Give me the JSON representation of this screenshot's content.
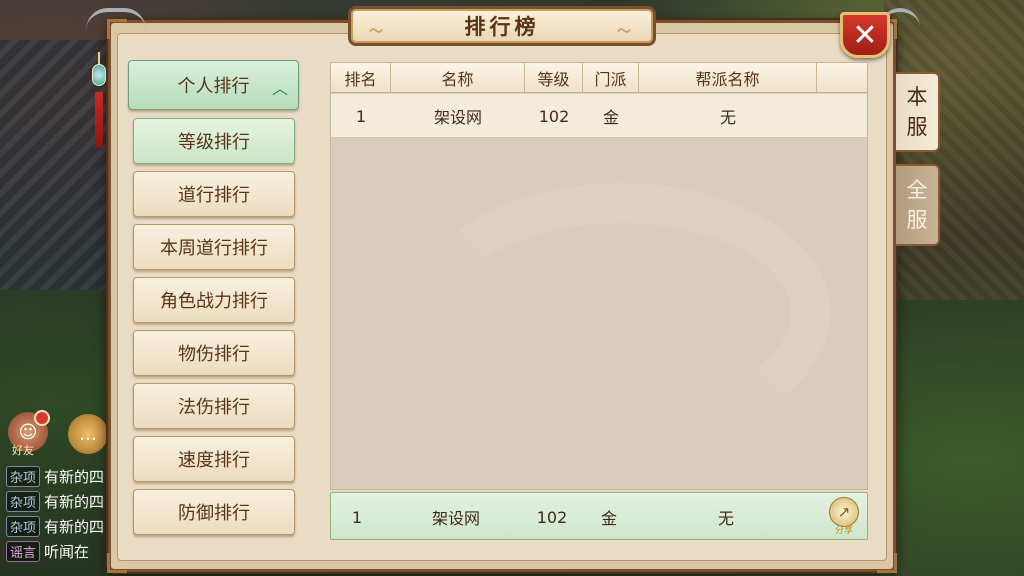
{
  "panel": {
    "title": "排行榜",
    "close_icon": "close-icon"
  },
  "categories": [
    {
      "label": "个人排行",
      "state": "expanded"
    },
    {
      "label": "等级排行",
      "state": "selected"
    },
    {
      "label": "道行排行",
      "state": "normal"
    },
    {
      "label": "本周道行排行",
      "state": "normal"
    },
    {
      "label": "角色战力排行",
      "state": "normal"
    },
    {
      "label": "物伤排行",
      "state": "normal"
    },
    {
      "label": "法伤排行",
      "state": "normal"
    },
    {
      "label": "速度排行",
      "state": "normal"
    },
    {
      "label": "防御排行",
      "state": "normal"
    }
  ],
  "table": {
    "columns": [
      "排名",
      "名称",
      "等级",
      "门派",
      "帮派名称"
    ],
    "rows": [
      {
        "rank": "1",
        "name": "架设网",
        "level": "102",
        "school": "金",
        "guild": "无"
      }
    ]
  },
  "my_rank": {
    "rank": "1",
    "name": "架设网",
    "level": "102",
    "school": "金",
    "guild": "无"
  },
  "share": {
    "label": "分享",
    "icon": "share-icon"
  },
  "server_tabs": [
    {
      "label_top": "本",
      "label_bottom": "服",
      "state": "active"
    },
    {
      "label_top": "全",
      "label_bottom": "服",
      "state": "inactive"
    }
  ],
  "chat": {
    "friend_label": "好友",
    "lines": [
      {
        "tag": "杂项",
        "text": "有新的四"
      },
      {
        "tag": "杂项",
        "text": "有新的四"
      },
      {
        "tag": "杂项",
        "text": "有新的四"
      },
      {
        "tag": "谣言",
        "text": "听闻在"
      }
    ]
  },
  "colors": {
    "panel_bg": "#eadcc4",
    "frame": "#7a4f2e",
    "selected_green": "#cbe6c6",
    "close_red": "#c52b22",
    "text_brown": "#5a3418"
  }
}
